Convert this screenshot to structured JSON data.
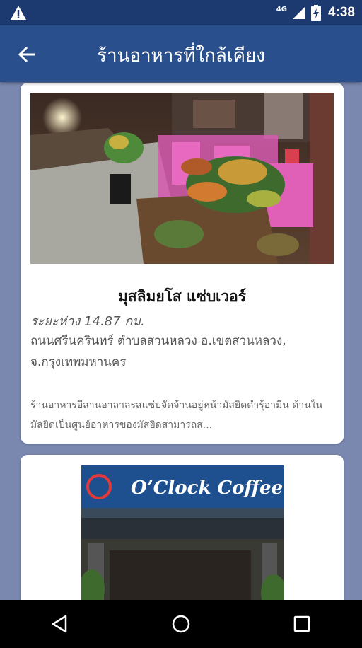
{
  "status_bar": {
    "network": "4G",
    "time": "4:38"
  },
  "app_bar": {
    "title": "ร้านอาหารที่ใกล้เคียง"
  },
  "restaurants": [
    {
      "name": "มุสลิมยโส แซ่บเวอร์",
      "distance": "ระยะห่าง 14.87 กม.",
      "address": "ถนนศรีนครินทร์ ตำบลสวนหลวง อ.เขตสวนหลวง, จ.กรุงเทพมหานคร",
      "description": "ร้านอาหารอีสานอาลาลรสแซ่บจัดจ้านอยู่หน้ามัสยิดดำรุ้อามีน ด้านในมัสยิดเป็นศูนย์อาหารของมัสยิดสามารถส...",
      "photo_icon": "restaurant-photo"
    },
    {
      "sign_text": "O’Clock Coffee",
      "photo_icon": "cafe-photo"
    }
  ],
  "icons": {
    "warning": "warning-icon",
    "signal": "signal-icon",
    "battery": "battery-icon",
    "back": "arrow-left-icon",
    "nav_back": "triangle-back-icon",
    "nav_home": "circle-home-icon",
    "nav_recent": "square-recent-icon"
  },
  "colors": {
    "status_bar": "#1c3a70",
    "app_bar": "#2a4f8d",
    "background": "#7a88b0",
    "card": "#ffffff"
  }
}
